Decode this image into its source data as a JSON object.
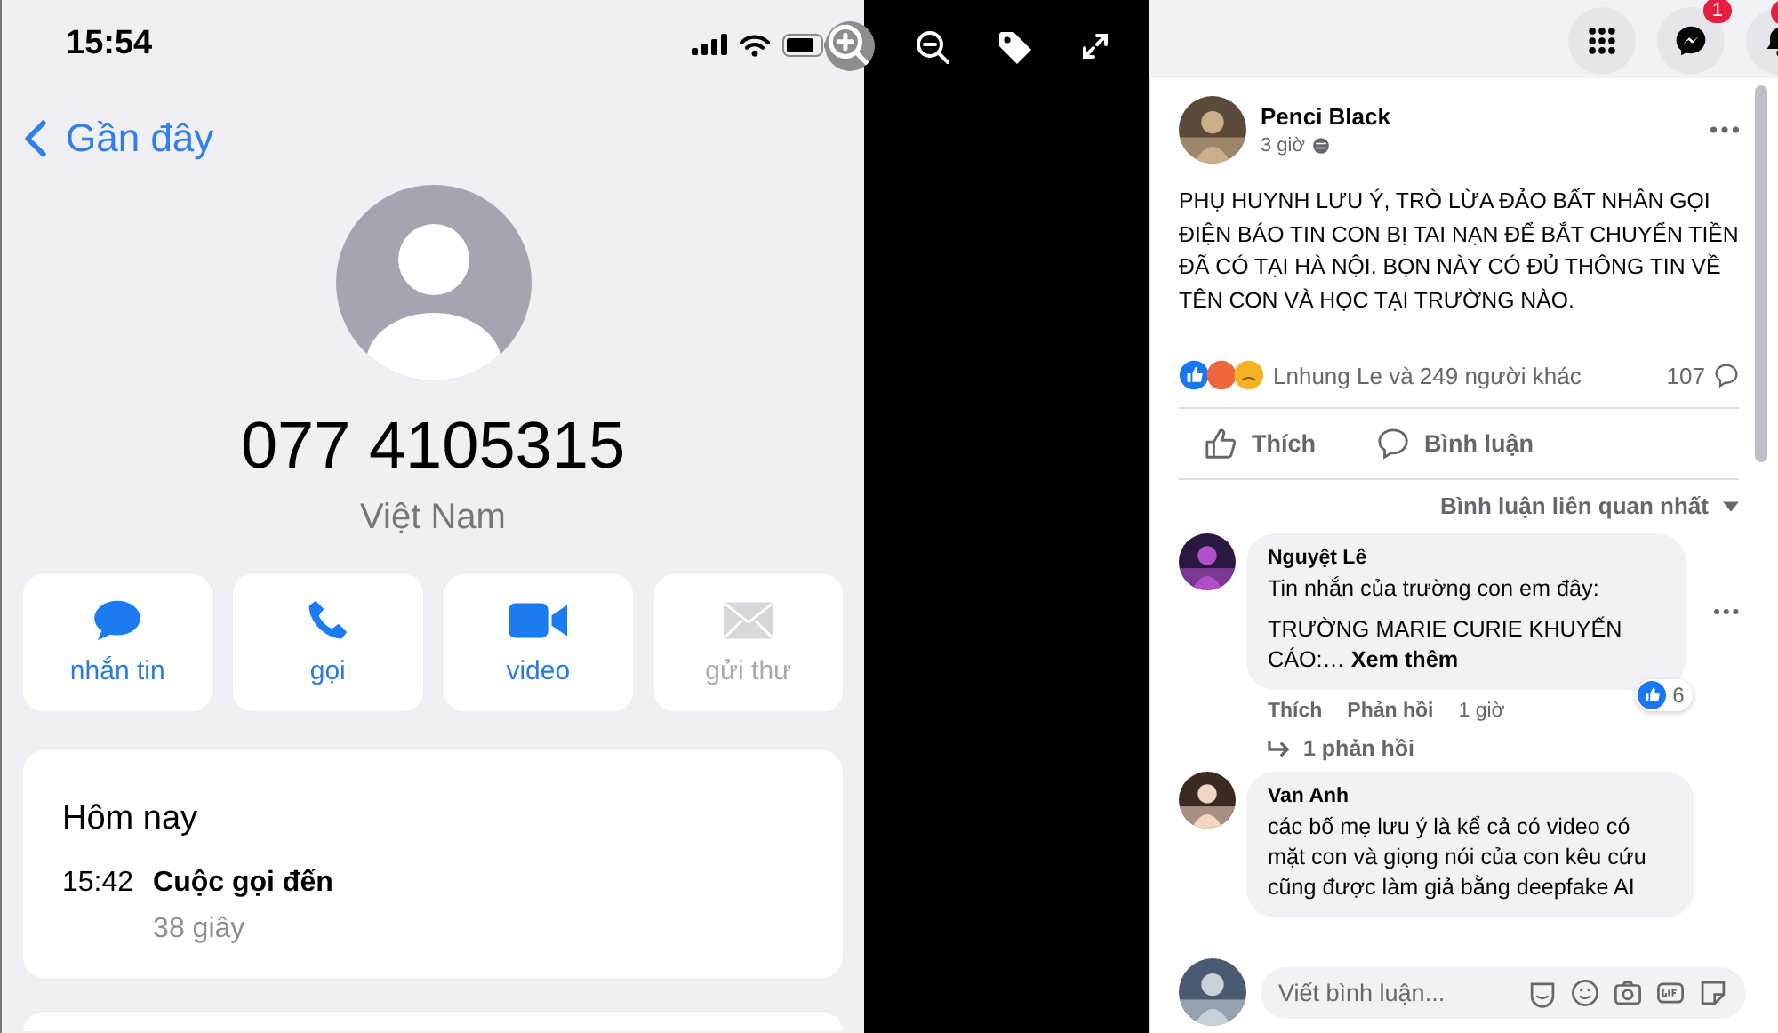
{
  "phone": {
    "status_bar": {
      "time": "15:54"
    },
    "back": {
      "label": "Gần đây"
    },
    "number": "077 4105315",
    "country": "Việt Nam",
    "actions": [
      {
        "label": "nhắn tin",
        "kind": "message",
        "disabled": false
      },
      {
        "label": "gọi",
        "kind": "phone",
        "disabled": false
      },
      {
        "label": "video",
        "kind": "video",
        "disabled": false
      },
      {
        "label": "gửi thư",
        "kind": "mail",
        "disabled": true
      }
    ],
    "history": {
      "heading": "Hôm nay",
      "entries": [
        {
          "time": "15:42",
          "type": "Cuộc gọi đến",
          "duration": "38 giây"
        }
      ]
    }
  },
  "viewer_toolbar": [
    {
      "kind": "zoom-in"
    },
    {
      "kind": "zoom-out"
    },
    {
      "kind": "tag"
    },
    {
      "kind": "fullscreen"
    }
  ],
  "facebook": {
    "top_icons": [
      {
        "kind": "grid"
      },
      {
        "kind": "messenger",
        "badge": "1"
      },
      {
        "kind": "bell",
        "dot": true
      }
    ],
    "post": {
      "author": "Penci Black",
      "time": "3 giờ",
      "text": "PHỤ HUYNH LƯU Ý, TRÒ LỪA ĐẢO BẤT NHÂN GỌI ĐIỆN BÁO TIN CON BỊ TAI NẠN ĐỂ BẮT CHUYỂN TIỀN ĐÃ CÓ TẠI HÀ NỘI. BỌN NÀY CÓ ĐỦ THÔNG TIN VỀ TÊN CON VÀ HỌC TẠI TRƯỜNG NÀO.",
      "reactions": "Lnhung Le và 249 người khác",
      "comment_count": "107",
      "actions": [
        {
          "label": "Thích",
          "kind": "like"
        },
        {
          "label": "Bình luận",
          "kind": "comment"
        }
      ],
      "sort": "Bình luận liên quan nhất"
    },
    "comments": [
      {
        "author": "Nguyệt Lê",
        "paragraphs": [
          "Tin nhắn của trường con em đây:",
          "TRƯỜNG MARIE CURIE KHUYẾN CÁO:…"
        ],
        "see_more": "Xem thêm",
        "like": "Thích",
        "reply": "Phản hồi",
        "time": "1 giờ",
        "reaction_count": "6",
        "replies": "1 phản hồi"
      },
      {
        "author": "Van Anh",
        "paragraphs": [
          "các bố mẹ lưu ý là kể cả có video có mặt con và giọng nói của con kêu cứu cũng được làm giả bằng deepfake AI"
        ]
      }
    ],
    "composer": {
      "placeholder": "Viết bình luận..."
    }
  }
}
